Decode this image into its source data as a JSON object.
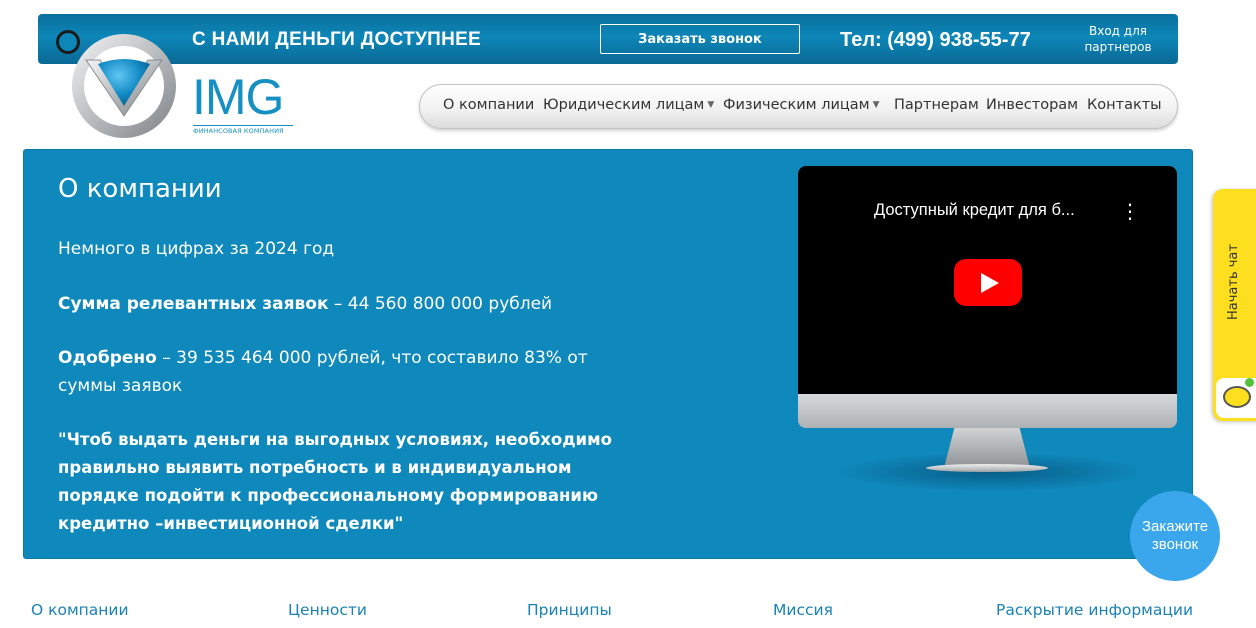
{
  "header": {
    "slogan": "С НАМИ ДЕНЬГИ ДОСТУПНЕЕ",
    "callback_button": "Заказать звонок",
    "phone": "Тел: (499) 938-55-77",
    "partners_login": "Вход для партнеров"
  },
  "logo": {
    "text": "IMG",
    "subtitle": "ФИНАНСОВАЯ КОМПАНИЯ"
  },
  "nav": {
    "items": [
      {
        "label": "О компании"
      },
      {
        "label": "Юридическим лицам",
        "has_dropdown": true
      },
      {
        "label": "Физическим лицам",
        "has_dropdown": true
      },
      {
        "label": "Партнерам"
      },
      {
        "label": "Инвесторам"
      },
      {
        "label": "Контакты"
      }
    ]
  },
  "hero": {
    "title": "О компании",
    "intro": "Немного в цифрах за 2024 год",
    "stat1_label": "Сумма релевантных заявок",
    "stat1_value": " – 44 560 800 000 рублей",
    "stat2_label": "Одобрено",
    "stat2_value_line1": " – 39 535 464 000 рублей, что составило 83% от",
    "stat2_value_line2": "суммы заявок",
    "quote_line1": "\"Чтоб выдать деньги на выгодных условиях, необходимо",
    "quote_line2": "правильно выявить потребность и в индивидуальном",
    "quote_line3": "порядке подойти к профессиональному формированию",
    "quote_line4": "кредитно –инвестиционной сделки\""
  },
  "video": {
    "title": "Доступный кредит для б...",
    "menu_icon": "more-vertical-icon",
    "play_icon": "play-icon"
  },
  "widgets": {
    "chat_label": "Начать чат",
    "call_line1": "Закажите",
    "call_line2": "звонок"
  },
  "subnav": {
    "items": [
      "О компании",
      "Ценности",
      "Принципы",
      "Миссия",
      "Раскрытие информации"
    ]
  },
  "colors": {
    "brand_blue": "#0f89bc",
    "topbar_blue": "#0d86b8",
    "link_blue": "#1a82b6",
    "chat_yellow": "#fddf1f",
    "call_blue": "#3aa6ec",
    "youtube_red": "#ff0000"
  }
}
